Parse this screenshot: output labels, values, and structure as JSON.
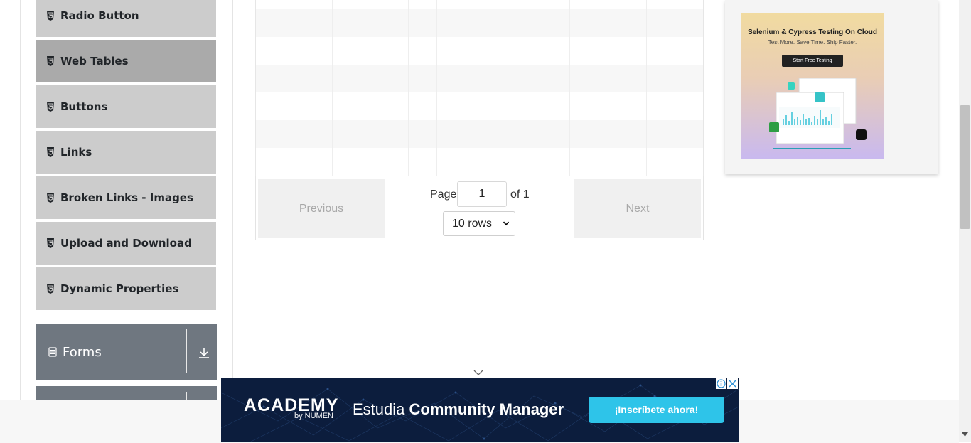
{
  "sidebar": {
    "items": [
      {
        "label": "Radio Button",
        "icon": "html5-icon",
        "active": false
      },
      {
        "label": "Web Tables",
        "icon": "html5-icon",
        "active": true
      },
      {
        "label": "Buttons",
        "icon": "html5-icon",
        "active": false
      },
      {
        "label": "Links",
        "icon": "html5-icon",
        "active": false
      },
      {
        "label": "Broken Links - Images",
        "icon": "html5-icon",
        "active": false
      },
      {
        "label": "Upload and Download",
        "icon": "html5-icon",
        "active": false
      },
      {
        "label": "Dynamic Properties",
        "icon": "html5-icon",
        "active": false
      }
    ],
    "groups": [
      {
        "label": "Forms",
        "icon": "document-icon",
        "toggle_icon": "download-arrow-icon"
      }
    ]
  },
  "table": {
    "empty_rows": 6
  },
  "pagination": {
    "previous_label": "Previous",
    "next_label": "Next",
    "page_label": "Page",
    "page_value": "1",
    "of_label": "of 1",
    "rows_selected": "10 rows"
  },
  "side_ad": {
    "title": "Selenium & Cypress Testing On Cloud",
    "subtitle": "Test More. Save Time. Ship Faster.",
    "cta": "Start Free Testing"
  },
  "banner_ad": {
    "logo": "ACADEMY",
    "logo_by": "by NUMEN",
    "text_prefix": "Estudia ",
    "text_bold": "Community Manager",
    "cta": "¡Inscríbete ahora!"
  },
  "colors": {
    "sidebar_item": "#cccccc",
    "sidebar_active": "#aaaaaa",
    "group_header": "#6f7780",
    "banner_bg": "#0c1d3d",
    "banner_cta": "#2ec4e9"
  }
}
